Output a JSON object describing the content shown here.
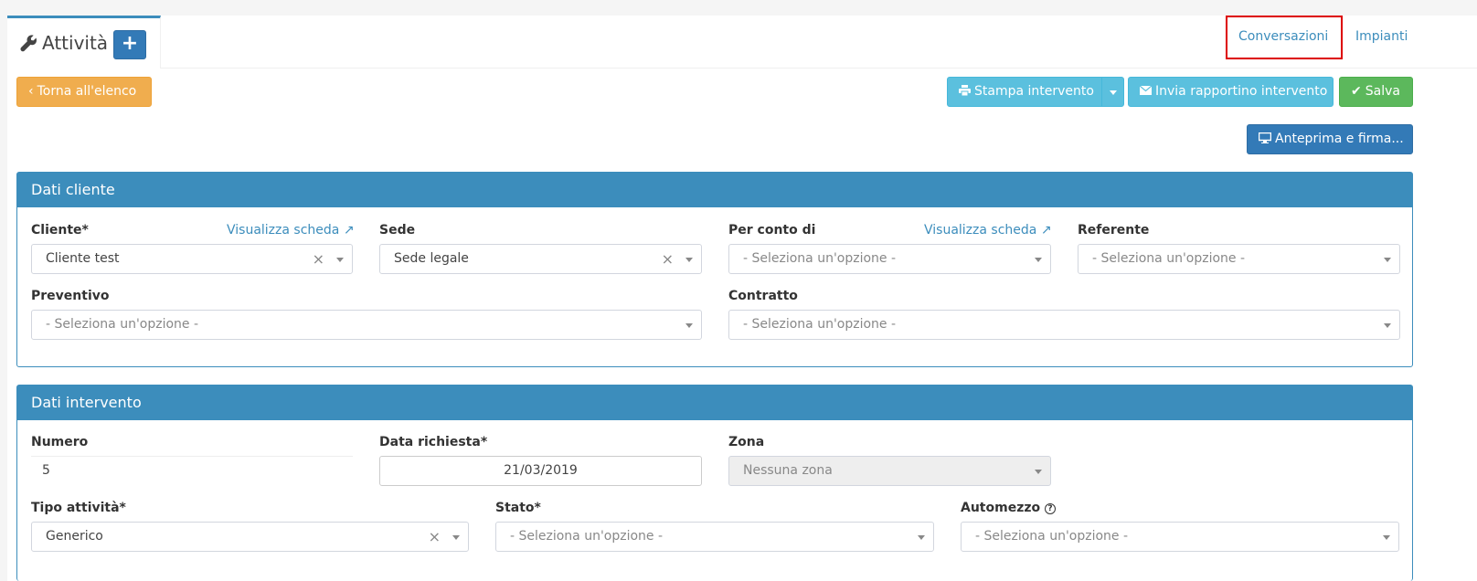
{
  "header": {
    "title": "Attività",
    "add_label": "+",
    "tabs": [
      "Conversazioni",
      "Impianti"
    ]
  },
  "toolbar": {
    "back_label": "Torna all'elenco",
    "print_label": "Stampa intervento",
    "send_label": "Invia rapportino intervento",
    "save_label": "Salva",
    "preview_label": "Anteprima e firma..."
  },
  "dati_cliente": {
    "title": "Dati cliente",
    "cliente": {
      "label": "Cliente*",
      "link": "Visualizza scheda",
      "value": "Cliente test"
    },
    "sede": {
      "label": "Sede",
      "value": "Sede legale"
    },
    "per_conto_di": {
      "label": "Per conto di",
      "link": "Visualizza scheda",
      "value": "- Seleziona un'opzione -"
    },
    "referente": {
      "label": "Referente",
      "value": "- Seleziona un'opzione -"
    },
    "preventivo": {
      "label": "Preventivo",
      "value": "- Seleziona un'opzione -"
    },
    "contratto": {
      "label": "Contratto",
      "value": "- Seleziona un'opzione -"
    }
  },
  "dati_intervento": {
    "title": "Dati intervento",
    "numero": {
      "label": "Numero",
      "value": "5"
    },
    "data_richiesta": {
      "label": "Data richiesta*",
      "value": "21/03/2019"
    },
    "zona": {
      "label": "Zona",
      "value": "Nessuna zona"
    },
    "tipo_attivita": {
      "label": "Tipo attività*",
      "value": "Generico"
    },
    "stato": {
      "label": "Stato*",
      "value": "- Seleziona un'opzione -"
    },
    "automezzo": {
      "label": "Automezzo",
      "value": "- Seleziona un'opzione -"
    }
  },
  "colors": {
    "primary": "#3c8dbc",
    "warning": "#f0ad4e",
    "info": "#5bc0de",
    "success": "#5cb85c",
    "highlight": "#dd0000"
  }
}
